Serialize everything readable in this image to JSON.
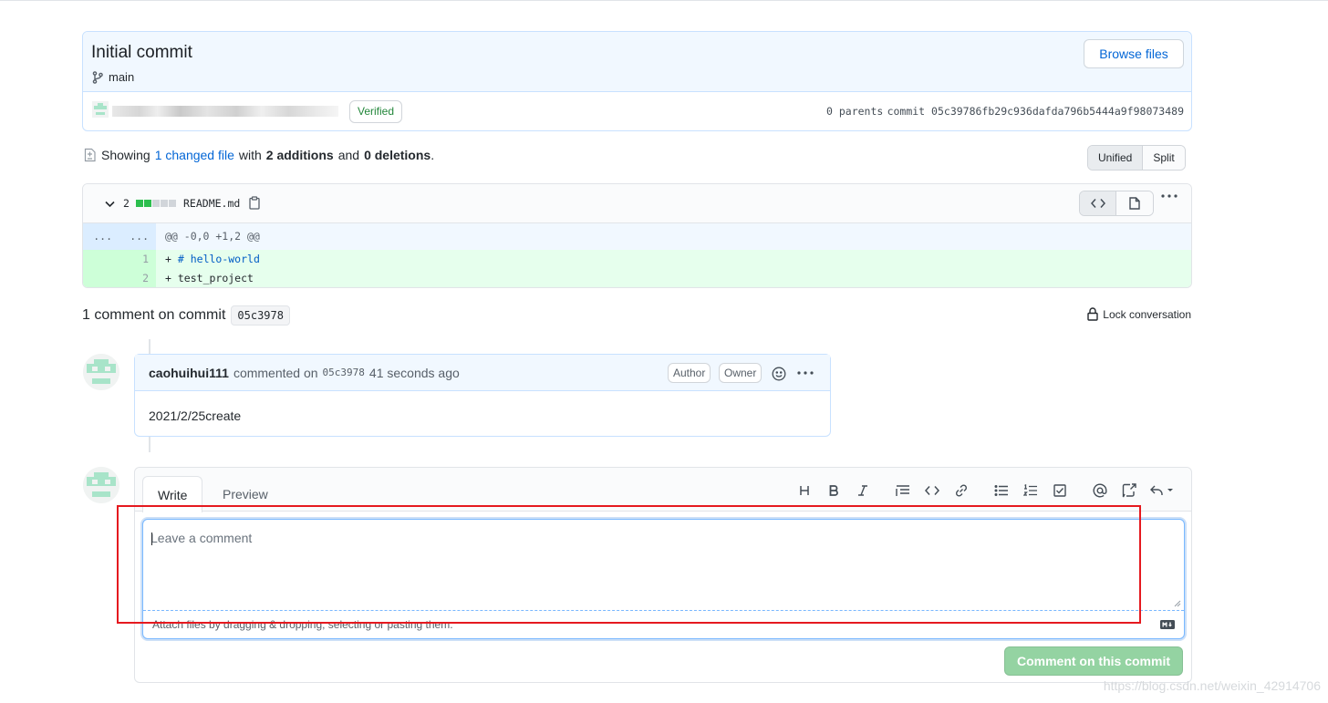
{
  "commit": {
    "title": "Initial commit",
    "branch": "main",
    "browse_label": "Browse files",
    "verified_label": "Verified",
    "parents": "0 parents",
    "sha_label": "commit",
    "sha": "05c39786fb29c936dafda796b5444a9f98073489"
  },
  "toc": {
    "showing": "Showing",
    "changed_files": "1 changed file",
    "with": "with",
    "additions": "2 additions",
    "and": "and",
    "deletions": "0 deletions",
    "period": ".",
    "view_unified": "Unified",
    "view_split": "Split"
  },
  "file": {
    "changes": "2",
    "name": "README.md",
    "hunk_left": "...",
    "hunk_right": "...",
    "hunk_header": "@@ -0,0 +1,2 @@",
    "lines": [
      {
        "num": "1",
        "marker": "+",
        "kw": "# hello-world",
        "text": ""
      },
      {
        "num": "2",
        "marker": "+",
        "kw": "",
        "text": "test_project"
      }
    ]
  },
  "comments_section": {
    "title": "1 comment on commit",
    "sha_short": "05c3978",
    "lock_label": "Lock conversation"
  },
  "comment": {
    "author": "caohuihui111",
    "action": "commented on",
    "sha": "05c3978",
    "time": "41 seconds ago",
    "badge_author": "Author",
    "badge_owner": "Owner",
    "body": "2021/2/25create"
  },
  "form": {
    "tab_write": "Write",
    "tab_preview": "Preview",
    "placeholder": "Leave a comment",
    "attach_hint": "Attach files by dragging & dropping, selecting or pasting them.",
    "submit_label": "Comment on this commit",
    "toolbar": [
      "heading-icon",
      "bold-icon",
      "italic-icon",
      "quote-icon",
      "code-icon",
      "link-icon",
      "unordered-list-icon",
      "ordered-list-icon",
      "task-list-icon",
      "mention-icon",
      "reference-icon",
      "reply-icon"
    ]
  },
  "colors": {
    "link": "#0366d6",
    "verified": "#22863a",
    "addition_bg": "#e6ffed",
    "submit_disabled": "#94d3a2",
    "highlight": "#e5191f"
  },
  "watermark": "https://blog.csdn.net/weixin_42914706"
}
